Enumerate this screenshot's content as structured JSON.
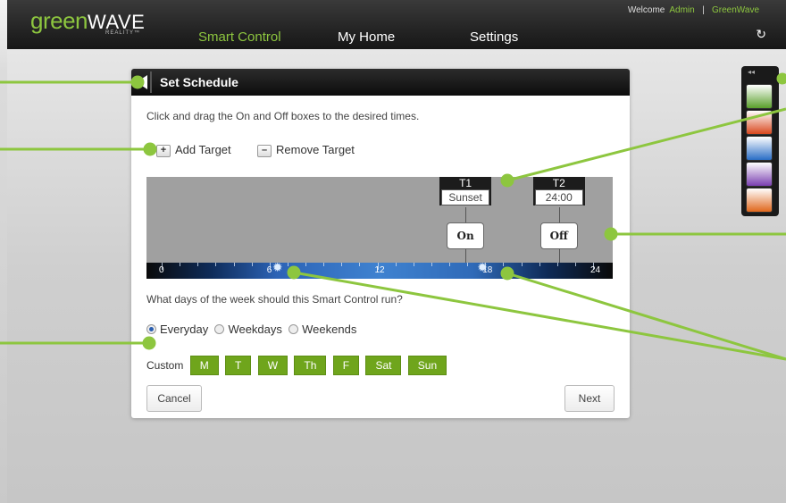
{
  "header": {
    "logo": "greenWAVE",
    "logo_sub": "REALITY™",
    "nav": [
      "Smart Control",
      "My Home",
      "Settings"
    ],
    "active_nav": "Smart Control",
    "welcome": "Welcome",
    "user": "Admin",
    "separator": "|",
    "org": "GreenWave",
    "refresh_icon": "refresh-icon"
  },
  "dialog": {
    "title": "Set Schedule",
    "instructions": "Click and drag the On and Off boxes to the desired times.",
    "add_target": "Add Target",
    "remove_target": "Remove Target",
    "hours": [
      "0",
      "6",
      "12",
      "18",
      "24"
    ],
    "targets": [
      {
        "label": "T1",
        "time": "Sunset",
        "state": "On",
        "hour": 16.9
      },
      {
        "label": "T2",
        "time": "24:00",
        "state": "Off",
        "hour": 22.1
      }
    ],
    "sun_icons": [
      {
        "name": "sunrise-icon",
        "hour": 6.5
      },
      {
        "name": "sunset-icon",
        "hour": 17.9
      }
    ],
    "question": "What days of the week should this Smart Control run?",
    "radios": [
      {
        "label": "Everyday",
        "checked": true
      },
      {
        "label": "Weekdays",
        "checked": false
      },
      {
        "label": "Weekends",
        "checked": false
      }
    ],
    "custom_label": "Custom",
    "days": [
      "M",
      "T",
      "W",
      "Th",
      "F",
      "Sat",
      "Sun"
    ],
    "cancel": "Cancel",
    "next": "Next"
  },
  "toolbar": {
    "collapse": "◂◂",
    "icons": [
      {
        "name": "home-icon",
        "color": "#5aa02c"
      },
      {
        "name": "away-icon",
        "color": "#d9481f"
      },
      {
        "name": "night-icon",
        "color": "#2a6ec6"
      },
      {
        "name": "timer-icon",
        "color": "#7a3fb0"
      },
      {
        "name": "vacation-icon",
        "color": "#e0671c"
      }
    ]
  },
  "colors": {
    "accent": "#8dc63f",
    "callout": "#8dc63f",
    "day_button": "#6fa51c"
  }
}
